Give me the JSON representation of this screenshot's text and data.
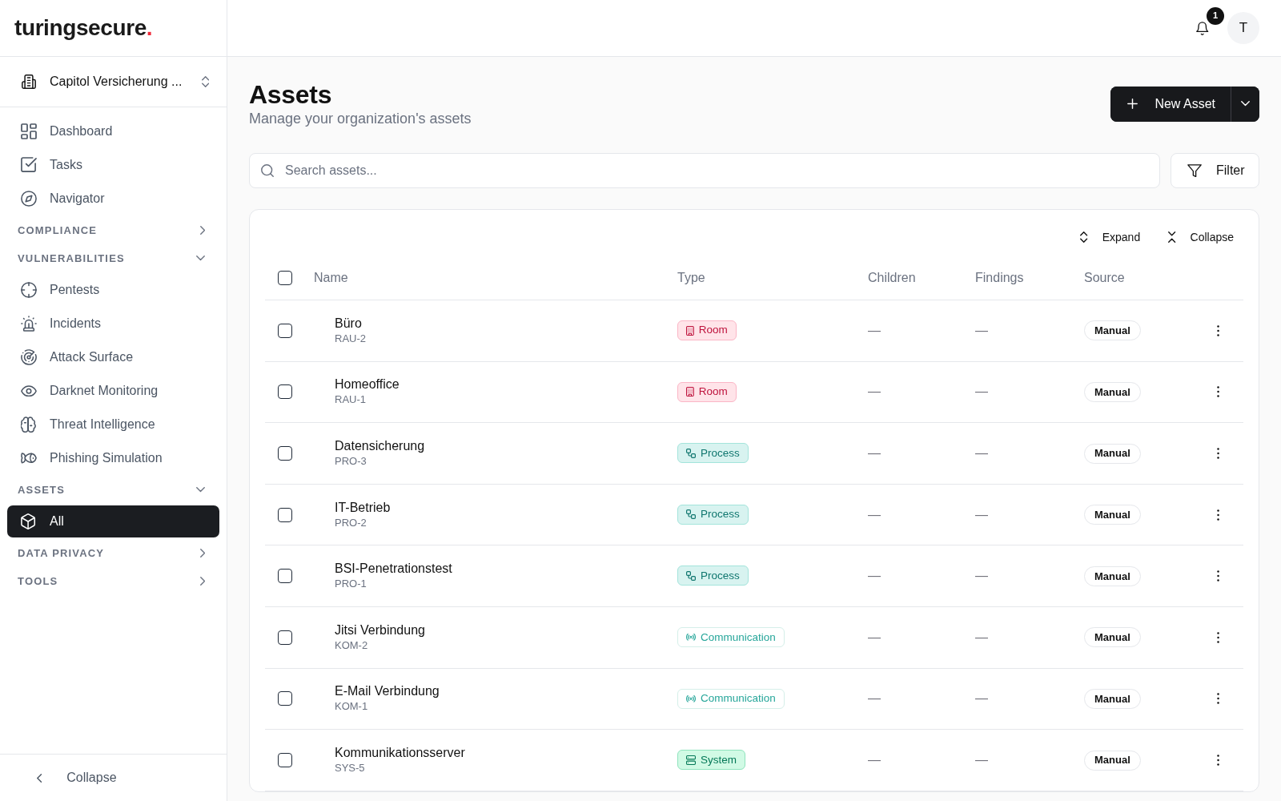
{
  "brand": {
    "name": "turingsecure",
    "accent": "."
  },
  "organization": {
    "label": "Capitol Versicherung ..."
  },
  "sidebar": {
    "items": [
      {
        "kind": "link",
        "label": "Dashboard",
        "selected": false
      },
      {
        "kind": "link",
        "label": "Tasks",
        "selected": false
      },
      {
        "kind": "link",
        "label": "Navigator",
        "selected": false
      },
      {
        "kind": "section",
        "label": "COMPLIANCE",
        "expanded": false
      },
      {
        "kind": "section",
        "label": "VULNERABILITIES",
        "expanded": true,
        "children": [
          {
            "kind": "link",
            "label": "Pentests",
            "selected": false
          },
          {
            "kind": "link",
            "label": "Incidents",
            "selected": false
          },
          {
            "kind": "link",
            "label": "Attack Surface",
            "selected": false
          },
          {
            "kind": "link",
            "label": "Darknet Monitoring",
            "selected": false
          },
          {
            "kind": "link",
            "label": "Threat Intelligence",
            "selected": false
          },
          {
            "kind": "link",
            "label": "Phishing Simulation",
            "selected": false
          }
        ]
      },
      {
        "kind": "section",
        "label": "ASSETS",
        "expanded": true,
        "children": [
          {
            "kind": "link",
            "label": "All",
            "selected": true
          }
        ]
      },
      {
        "kind": "section",
        "label": "DATA PRIVACY",
        "expanded": false
      },
      {
        "kind": "section",
        "label": "TOOLS",
        "expanded": false
      }
    ],
    "collapse_label": "Collapse"
  },
  "top_bar": {
    "notification_count": "1",
    "avatar_initial": "T"
  },
  "page": {
    "title": "Assets",
    "subtitle": "Manage your organization's assets"
  },
  "actions": {
    "new_asset_label": "New Asset"
  },
  "search": {
    "placeholder": "Search assets..."
  },
  "filter": {
    "label": "Filter"
  },
  "table": {
    "toolbar": [
      {
        "kind": "expand",
        "label": "Expand"
      },
      {
        "kind": "collapse",
        "label": "Collapse"
      }
    ],
    "select_all": {
      "checked": false
    },
    "columns": [
      "Name",
      "Type",
      "Children",
      "Findings",
      "Source"
    ],
    "rows": [
      {
        "checked": false,
        "name": "Büro",
        "id": "RAU-2",
        "type": {
          "kind": "room",
          "label": "Room"
        },
        "children": "—",
        "findings": "—",
        "source": "Manual"
      },
      {
        "checked": false,
        "name": "Homeoffice",
        "id": "RAU-1",
        "type": {
          "kind": "room",
          "label": "Room"
        },
        "children": "—",
        "findings": "—",
        "source": "Manual"
      },
      {
        "checked": false,
        "name": "Datensicherung",
        "id": "PRO-3",
        "type": {
          "kind": "process",
          "label": "Process"
        },
        "children": "—",
        "findings": "—",
        "source": "Manual"
      },
      {
        "checked": false,
        "name": "IT-Betrieb",
        "id": "PRO-2",
        "type": {
          "kind": "process",
          "label": "Process"
        },
        "children": "—",
        "findings": "—",
        "source": "Manual"
      },
      {
        "checked": false,
        "name": "BSI-Penetrationstest",
        "id": "PRO-1",
        "type": {
          "kind": "process",
          "label": "Process"
        },
        "children": "—",
        "findings": "—",
        "source": "Manual"
      },
      {
        "checked": false,
        "name": "Jitsi Verbindung",
        "id": "KOM-2",
        "type": {
          "kind": "communication",
          "label": "Communication"
        },
        "children": "—",
        "findings": "—",
        "source": "Manual"
      },
      {
        "checked": false,
        "name": "E-Mail Verbindung",
        "id": "KOM-1",
        "type": {
          "kind": "communication",
          "label": "Communication"
        },
        "children": "—",
        "findings": "—",
        "source": "Manual"
      },
      {
        "checked": false,
        "name": "Kommunikationsserver",
        "id": "SYS-5",
        "type": {
          "kind": "system",
          "label": "System"
        },
        "children": "—",
        "findings": "—",
        "source": "Manual"
      }
    ]
  }
}
